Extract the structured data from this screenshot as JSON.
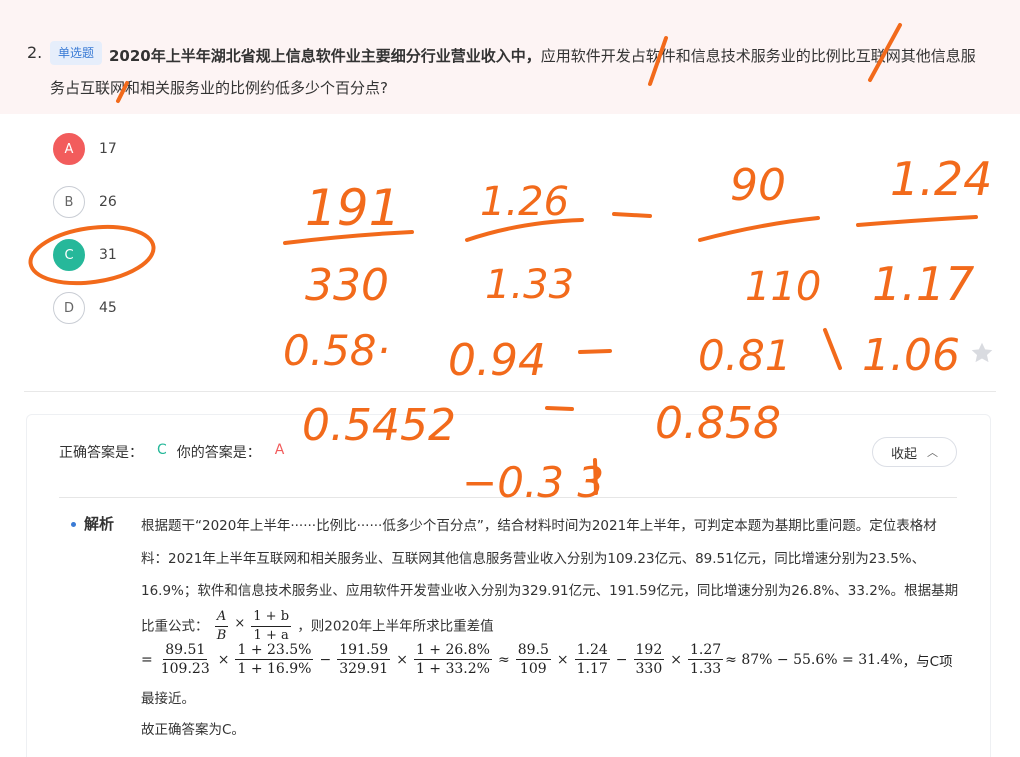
{
  "question": {
    "number": "2.",
    "tag": "单选题",
    "year_bold": "2020年上半年湖北省规上信息软件业主要细分行业营业收入中，",
    "text": "应用软件开发占软件和信息技术服务业的比例比互联网其他信息服务占互联网和相关服务业的比例约低多少个百分点?"
  },
  "options": [
    {
      "letter": "A",
      "value": "17",
      "state": "wrong"
    },
    {
      "letter": "B",
      "value": "26",
      "state": "normal"
    },
    {
      "letter": "C",
      "value": "31",
      "state": "right"
    },
    {
      "letter": "D",
      "value": "45",
      "state": "normal"
    }
  ],
  "answer": {
    "correct_label": "正确答案是：",
    "correct": "C",
    "yours_label": "你的答案是：",
    "yours": "A",
    "collapse": "收起"
  },
  "explanation": {
    "label": "解析",
    "para": "根据题干“2020年上半年······比例比······低多少个百分点”，结合材料时间为2021年上半年，可判定本题为基期比重问题。定位表格材料：2021年上半年互联网和相关服务业、互联网其他信息服务营业收入分别为109.23亿元、89.51亿元，同比增速分别为23.5%、16.9%；软件和信息技术服务业、应用软件开发营业收入分别为329.91亿元、191.59亿元，同比增速分别为26.8%、33.2%。根据基期比重公式：",
    "formula_tail": "，则2020年上半年所求比重差值",
    "formula_A": "A",
    "formula_B": "B",
    "formula_nb": "1 + b",
    "formula_na": "1 + a",
    "calc": {
      "f1n": "89.51",
      "f1d": "109.23",
      "f2n": "1 + 23.5%",
      "f2d": "1 + 16.9%",
      "f3n": "191.59",
      "f3d": "329.91",
      "f4n": "1 + 26.8%",
      "f4d": "1 + 33.2%",
      "f5n": "89.5",
      "f5d": "109",
      "f6n": "1.24",
      "f6d": "1.17",
      "f7n": "192",
      "f7d": "330",
      "f8n": "1.27",
      "f8d": "1.33",
      "result": "≈ 87% − 55.6% = 31.4%",
      "tail": "，与C项"
    },
    "cont": "最接近。",
    "final": "故正确答案为C。"
  },
  "handwriting": {
    "color": "#f26a1b",
    "lines": [
      "191/330",
      "1.26/1.33",
      "−",
      "90/110",
      "1.24/1.17",
      "0.58·",
      "0.94",
      "−",
      "0.81",
      "1.06",
      "0.5452",
      "−",
      "0.858",
      "−0.313"
    ]
  }
}
